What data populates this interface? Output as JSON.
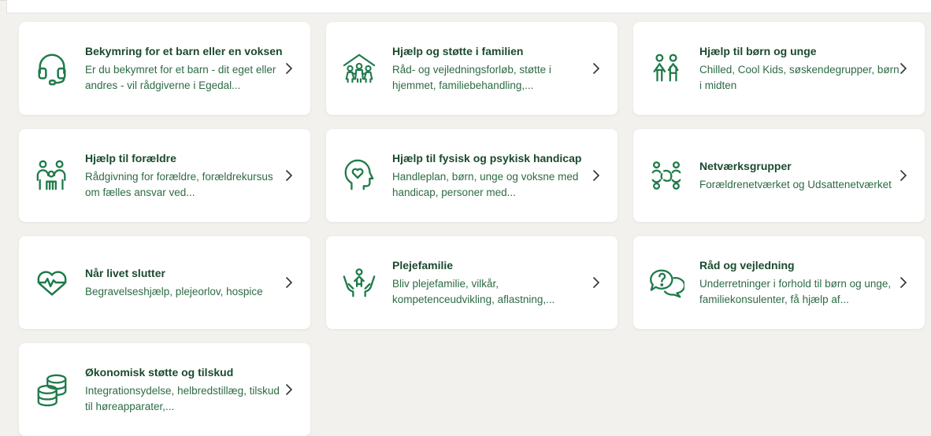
{
  "accent_color": "#1f7a4a",
  "title_color": "#1b4a2e",
  "cards": [
    {
      "title": "Bekymring for et barn eller en voksen",
      "desc": "Er du bekymret for et barn - dit eget eller andres - vil rådgiverne i Egedal...",
      "icon": "headset-icon"
    },
    {
      "title": "Hjælp og støtte i familien",
      "desc": "Råd- og vejledningsforløb, støtte i hjemmet, familiebehandling,...",
      "icon": "family-house-icon"
    },
    {
      "title": "Hjælp til børn og unge",
      "desc": "Chilled, Cool Kids, søskendegrupper, børn i midten",
      "icon": "children-icon"
    },
    {
      "title": "Hjælp til forældre",
      "desc": "Rådgivning for forældre, forældrekursus om fælles ansvar ved...",
      "icon": "parents-icon"
    },
    {
      "title": "Hjælp til fysisk og psykisk handicap",
      "desc": "Handleplan, børn, unge og voksne med handicap, personer med...",
      "icon": "head-heart-icon"
    },
    {
      "title": "Netværksgrupper",
      "desc": "Forældrenetværket og Udsattenetværket",
      "icon": "network-icon"
    },
    {
      "title": "Når livet slutter",
      "desc": "Begravelseshjælp, plejeorlov, hospice",
      "icon": "heartbeat-icon"
    },
    {
      "title": "Plejefamilie",
      "desc": "Bliv plejefamilie, vilkår, kompetenceudvikling, aflastning,...",
      "icon": "caring-hands-icon"
    },
    {
      "title": "Råd og vejledning",
      "desc": "Underretninger i forhold til børn og unge, familiekonsulenter, få hjælp af...",
      "icon": "speech-bubbles-icon"
    },
    {
      "title": "Økonomisk støtte og tilskud",
      "desc": "Integrationsydelse, helbredstillæg, tilskud til høreapparater,...",
      "icon": "coins-icon"
    }
  ]
}
